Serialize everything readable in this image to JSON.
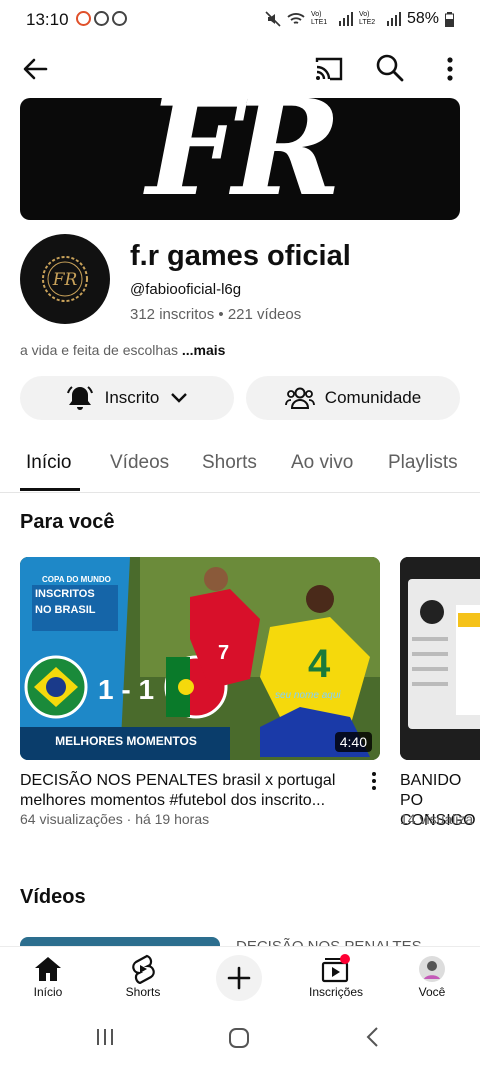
{
  "status_bar": {
    "time": "13:10",
    "battery": "58%",
    "signal1": "Vo) LTE1",
    "signal2": "Vo) LTE2"
  },
  "top_bar": {
    "icons": [
      "back-arrow-icon",
      "cast-icon",
      "search-icon",
      "more-vert-icon"
    ]
  },
  "banner": {
    "text": "FR"
  },
  "channel": {
    "avatar_text": "FR",
    "name": "f.r games oficial",
    "handle": "@fabiooficial-l6g",
    "subscribers": "312 inscritos",
    "separator": "•",
    "videos": "221 vídeos",
    "description": "a vida e feita de escolhas",
    "more": "...mais"
  },
  "actions": {
    "subscribed": "Inscrito",
    "community": "Comunidade"
  },
  "tabs": [
    "Início",
    "Vídeos",
    "Shorts",
    "Ao vivo",
    "Playlists"
  ],
  "section_for_you": "Para você",
  "videos": [
    {
      "title": "DECISÃO NOS PENALTES brasil x portugal melhores momentos #futebol dos inscrito...",
      "views": "64 visualizações",
      "separator": "·",
      "age": "há 19 horas",
      "duration": "4:40",
      "thumb": {
        "tag1": "COPA DO MUNDO",
        "tag2": "INSCRITOS",
        "tag3": "NO BRASIL",
        "score": "1 - 1",
        "banner": "MELHORES MOMENTOS",
        "watermark": "seu nome aqui",
        "jersey_num_left": "7",
        "jersey_num_right": "4"
      }
    },
    {
      "title": "BANIDO PO CONSIGO",
      "views": "14 visualiza"
    }
  ],
  "section_videos": "Vídeos",
  "peek_title": "DECISÃO NOS PENALTES",
  "bottom_nav": [
    {
      "label": "Início",
      "icon": "home-icon"
    },
    {
      "label": "Shorts",
      "icon": "shorts-icon"
    },
    {
      "label": "",
      "icon": "create-plus-icon"
    },
    {
      "label": "Inscrições",
      "icon": "subscriptions-icon"
    },
    {
      "label": "Você",
      "icon": "you-avatar-icon"
    }
  ],
  "colors": {
    "accent": "#0f0f0f",
    "secondary_text": "#606060",
    "chip_bg": "#f2f2f2",
    "notification_dot": "#ff0033",
    "brazil_yellow": "#f5d90c",
    "portugal_red": "#d8102a"
  }
}
